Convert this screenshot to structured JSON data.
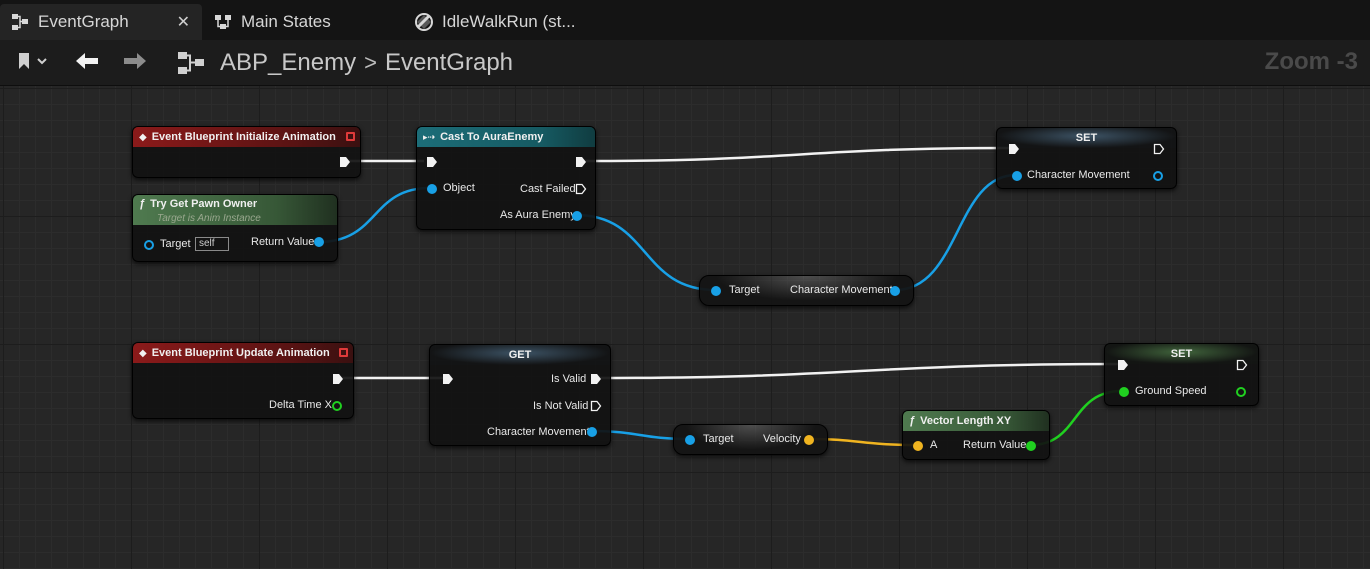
{
  "tabs": [
    {
      "label": "EventGraph",
      "close": "✕"
    },
    {
      "label": "Main States"
    },
    {
      "label": "IdleWalkRun (st..."
    }
  ],
  "toolbar": {
    "breadcrumb_root": "ABP_Enemy",
    "breadcrumb_separator": ">",
    "breadcrumb_current": "EventGraph",
    "zoom": "Zoom -3"
  },
  "nodes": {
    "init_event": {
      "title": "Event Blueprint Initialize Animation"
    },
    "try_get_pawn": {
      "title": "Try Get Pawn Owner",
      "subtitle": "Target is Anim Instance",
      "target_label": "Target",
      "self_value": "self",
      "return_label": "Return Value"
    },
    "cast": {
      "title": "Cast To AuraEnemy",
      "object_label": "Object",
      "cast_failed_label": "Cast Failed",
      "as_label": "As Aura Enemy"
    },
    "get_char_move_1": {
      "target_label": "Target",
      "output_label": "Character Movement"
    },
    "set_char_move": {
      "title": "SET",
      "var_label": "Character Movement"
    },
    "update_event": {
      "title": "Event Blueprint Update Animation",
      "delta_label": "Delta Time X"
    },
    "get_valid": {
      "title": "GET",
      "valid_label": "Is Valid",
      "not_valid_label": "Is Not Valid",
      "var_label": "Character Movement"
    },
    "get_velocity": {
      "target_label": "Target",
      "output_label": "Velocity"
    },
    "vector_length": {
      "title": "Vector Length XY",
      "a_label": "A",
      "return_label": "Return Value"
    },
    "set_ground_speed": {
      "title": "SET",
      "var_label": "Ground Speed"
    }
  },
  "colors": {
    "exec_wire": "#ffffff",
    "object_wire": "#18a0e6",
    "vector_wire": "#f0b420",
    "float_wire": "#20d020",
    "event_header": "#8b1a1a",
    "cast_header": "#1c6d78",
    "function_header": "#4f7a4f"
  },
  "icons": {
    "tab_eventgraph": "graph-icon",
    "tab_mainstates": "state-machine-icon",
    "tab_idlewalkrun": "blendspace-icon",
    "bookmark": "bookmark-icon",
    "back": "arrow-left-icon",
    "forward": "arrow-right-icon",
    "graph": "graph-icon"
  }
}
